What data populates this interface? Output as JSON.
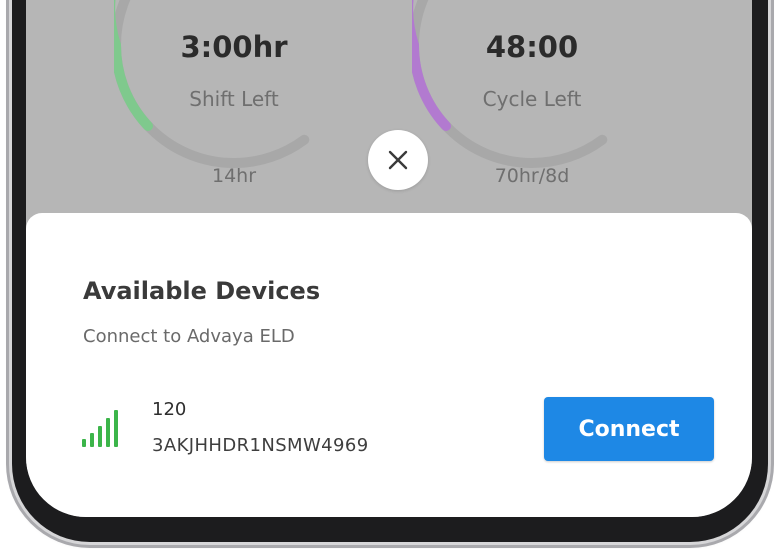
{
  "dashboard": {
    "shift": {
      "value": "3:00hr",
      "label": "Shift Left",
      "limit": "14hr",
      "color": "#7fc98d"
    },
    "cycle": {
      "value": "48:00",
      "label": "Cycle Left",
      "limit": "70hr/8d",
      "color": "#b27ad0"
    }
  },
  "close_icon": "close-icon",
  "sheet": {
    "title": "Available Devices",
    "subtitle": "Connect to Advaya ELD",
    "device": {
      "id": "120",
      "serial": "3AKJHHDR1NSMW4969",
      "signal_icon": "signal-strength-icon",
      "signal_color": "#3cb54a"
    },
    "connect_label": "Connect",
    "accent": "#1e88e5"
  }
}
